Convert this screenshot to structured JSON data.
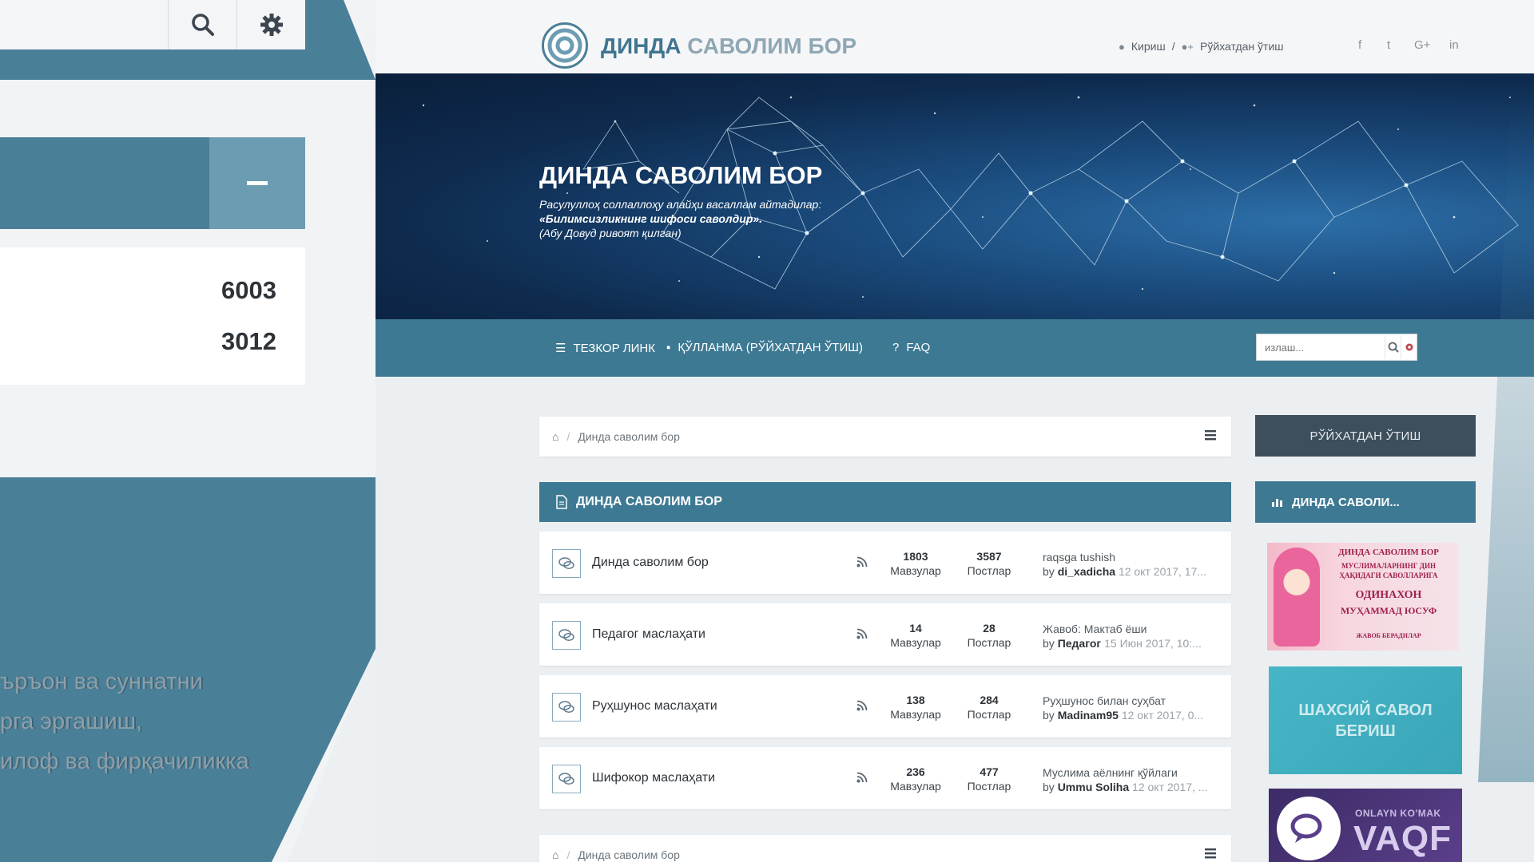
{
  "left_panel": {
    "stats": [
      "6003",
      "3012"
    ],
    "text_lines": [
      "ъръон ва суннатни",
      "рга эргашиш,",
      "илоф ва фирқачиликка"
    ]
  },
  "header": {
    "logo_part1": "ДИНДА",
    "logo_part2": "САВОЛИМ БОР",
    "login": "Кириш",
    "separator": "/",
    "register": "Рўйхатдан ўтиш",
    "social": [
      "f",
      "t",
      "G+",
      "in"
    ]
  },
  "hero": {
    "title": "ДИНДА САВОЛИМ БОР",
    "lines": [
      "Расулуллоҳ соллаллоҳу алайҳи васаллам айтадилар:",
      "«Билимсизликнинг шифоси саволдир».",
      "(Абу Довуд ривоят қилган)"
    ]
  },
  "nav": {
    "quick_links": "ТЕЗКОР ЛИНК",
    "guide": "ҚЎЛЛАНМА (РЎЙХАТДАН ЎТИШ)",
    "faq": "FAQ",
    "search_placeholder": "излаш..."
  },
  "breadcrumb": {
    "current": "Динда саволим бор"
  },
  "forum": {
    "header": "ДИНДА САВОЛИМ БОР",
    "topics_label": "Мавзулар",
    "posts_label": "Постлар",
    "by_label": "by",
    "rows": [
      {
        "title": "Динда саволим бор",
        "topics": "1803",
        "posts": "3587",
        "last_title": "raqsga tushish",
        "last_user": "di_xadicha",
        "last_date": "12 окт 2017, 17..."
      },
      {
        "title": "Педагог маслаҳати",
        "topics": "14",
        "posts": "28",
        "last_title": "Жавоб: Мактаб ёши",
        "last_user": "Педагог",
        "last_date": "15 Июн 2017, 10:..."
      },
      {
        "title": "Руҳшунос маслаҳати",
        "topics": "138",
        "posts": "284",
        "last_title": "Руҳшунос билан суҳбат",
        "last_user": "Madinam95",
        "last_date": "12 окт 2017, 0..."
      },
      {
        "title": "Шифокор маслаҳати",
        "topics": "236",
        "posts": "477",
        "last_title": "Муслима аёлнинг қўйлаги",
        "last_user": "Ummu Soliha",
        "last_date": "12 окт 2017, ..."
      }
    ]
  },
  "sidebar": {
    "register_button": "РЎЙХАТДАН ЎТИШ",
    "section_title": "ДИНДА САВОЛИ...",
    "ad1_lines": [
      "ДИНДА САВОЛИМ БОР",
      "МУСЛИМАЛАРНИНГ ДИН",
      "ҲАҚИДАГИ САВОЛЛАРИГА",
      "ОДИНАХОН",
      "МУҲАММАД ЮСУФ",
      "ЖАВОБ БЕРАДИЛАР"
    ],
    "ad2_lines": [
      "ШАХСИЙ САВОЛ",
      "БЕРИШ"
    ],
    "ad3_small": "ONLAYN KO'MAK",
    "ad3_big": "VAQF"
  },
  "colors": {
    "primary": "#3e7993",
    "dark_button": "#3d4e5c",
    "hero_bg": "#0e2a4d"
  }
}
